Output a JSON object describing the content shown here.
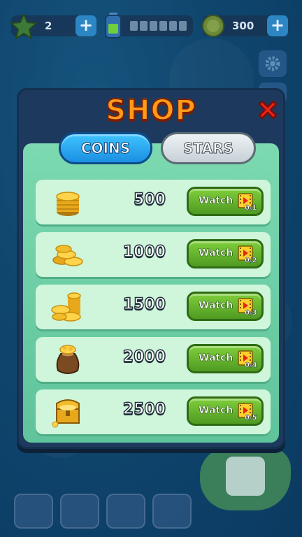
{
  "hud": {
    "stars": "2",
    "coins": "300",
    "plus_label": "+"
  },
  "shop": {
    "title": "SHOP",
    "tabs": [
      {
        "label": "COINS",
        "active": true
      },
      {
        "label": "STARS",
        "active": false
      }
    ],
    "watch_label": "Watch",
    "rows": [
      {
        "amount": "500",
        "progress": "0/1",
        "icon": "coin-stack-icon"
      },
      {
        "amount": "1000",
        "progress": "0/2",
        "icon": "coin-pile-icon"
      },
      {
        "amount": "1500",
        "progress": "0/3",
        "icon": "coin-piles-icon"
      },
      {
        "amount": "2000",
        "progress": "0/4",
        "icon": "coin-bag-icon"
      },
      {
        "amount": "2500",
        "progress": "0/5",
        "icon": "treasure-chest-icon"
      }
    ]
  },
  "colors": {
    "panel": "#1d3a5e",
    "inner": "#6fcfa6",
    "row": "#cff5da",
    "watch_button": "#5fae2c",
    "title": "#ff9a1a",
    "close": "#e8241a"
  }
}
